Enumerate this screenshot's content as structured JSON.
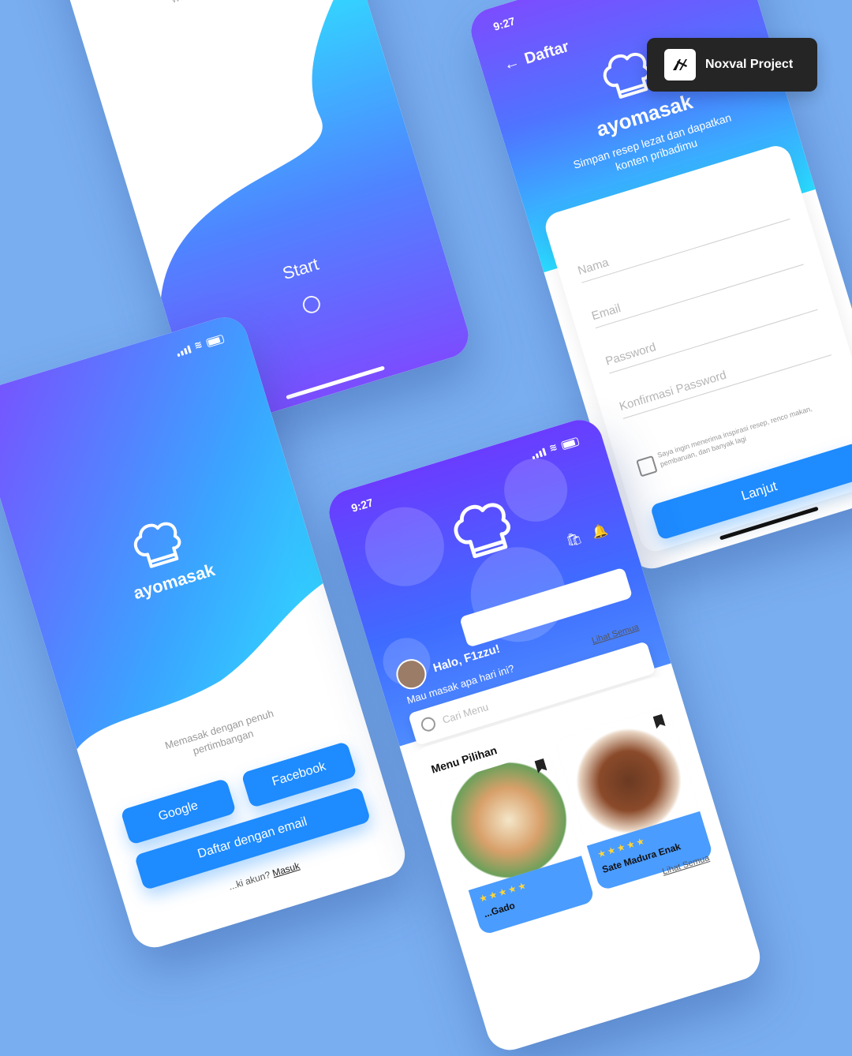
{
  "badge": {
    "label": "Noxval Project"
  },
  "welcome_screen": {
    "brand": "ayomasak",
    "subtitle": "Welcome To AyoMasak",
    "start_label": "Start"
  },
  "register_screen": {
    "time": "9:27",
    "back_label": "Daftar",
    "brand": "ayomasak",
    "tagline": "Simpan resep lezat dan dapatkan konten pribadimu",
    "fields": {
      "name": "Nama",
      "email": "Email",
      "password": "Password",
      "confirm_password": "Konfirmasi Password"
    },
    "consent_text": "Saya ingin menerima inspirasi resep, renco makan, pembaruan, dan banyak lagi",
    "continue_label": "Lanjut"
  },
  "login_screen": {
    "brand": "ayomasak",
    "tagline": "Memasak dengan penuh pertimbangan",
    "google_label": "Google",
    "facebook_label": "Facebook",
    "email_signup_label": "Daftar dengan email",
    "login_prompt": "...ki akun?",
    "login_link": "Masuk"
  },
  "home_screen": {
    "time": "9:27",
    "greeting": "Halo, F1zzu!",
    "question": "Mau masak apa hari ini?",
    "search_placeholder": "Cari Menu",
    "see_all_top": "Lihat Semua",
    "section_title": "Menu Pilihan",
    "see_all_bottom": "Lihat Semua",
    "menu": [
      {
        "name": "...Gado",
        "stars": "★★★★★"
      },
      {
        "name": "Sate Madura Enak",
        "stars": "★★★★★"
      }
    ]
  },
  "colors": {
    "background": "#79aef0",
    "primary": "#1e8bff",
    "gradient_start": "#7b4dff",
    "gradient_end": "#29dbff"
  }
}
